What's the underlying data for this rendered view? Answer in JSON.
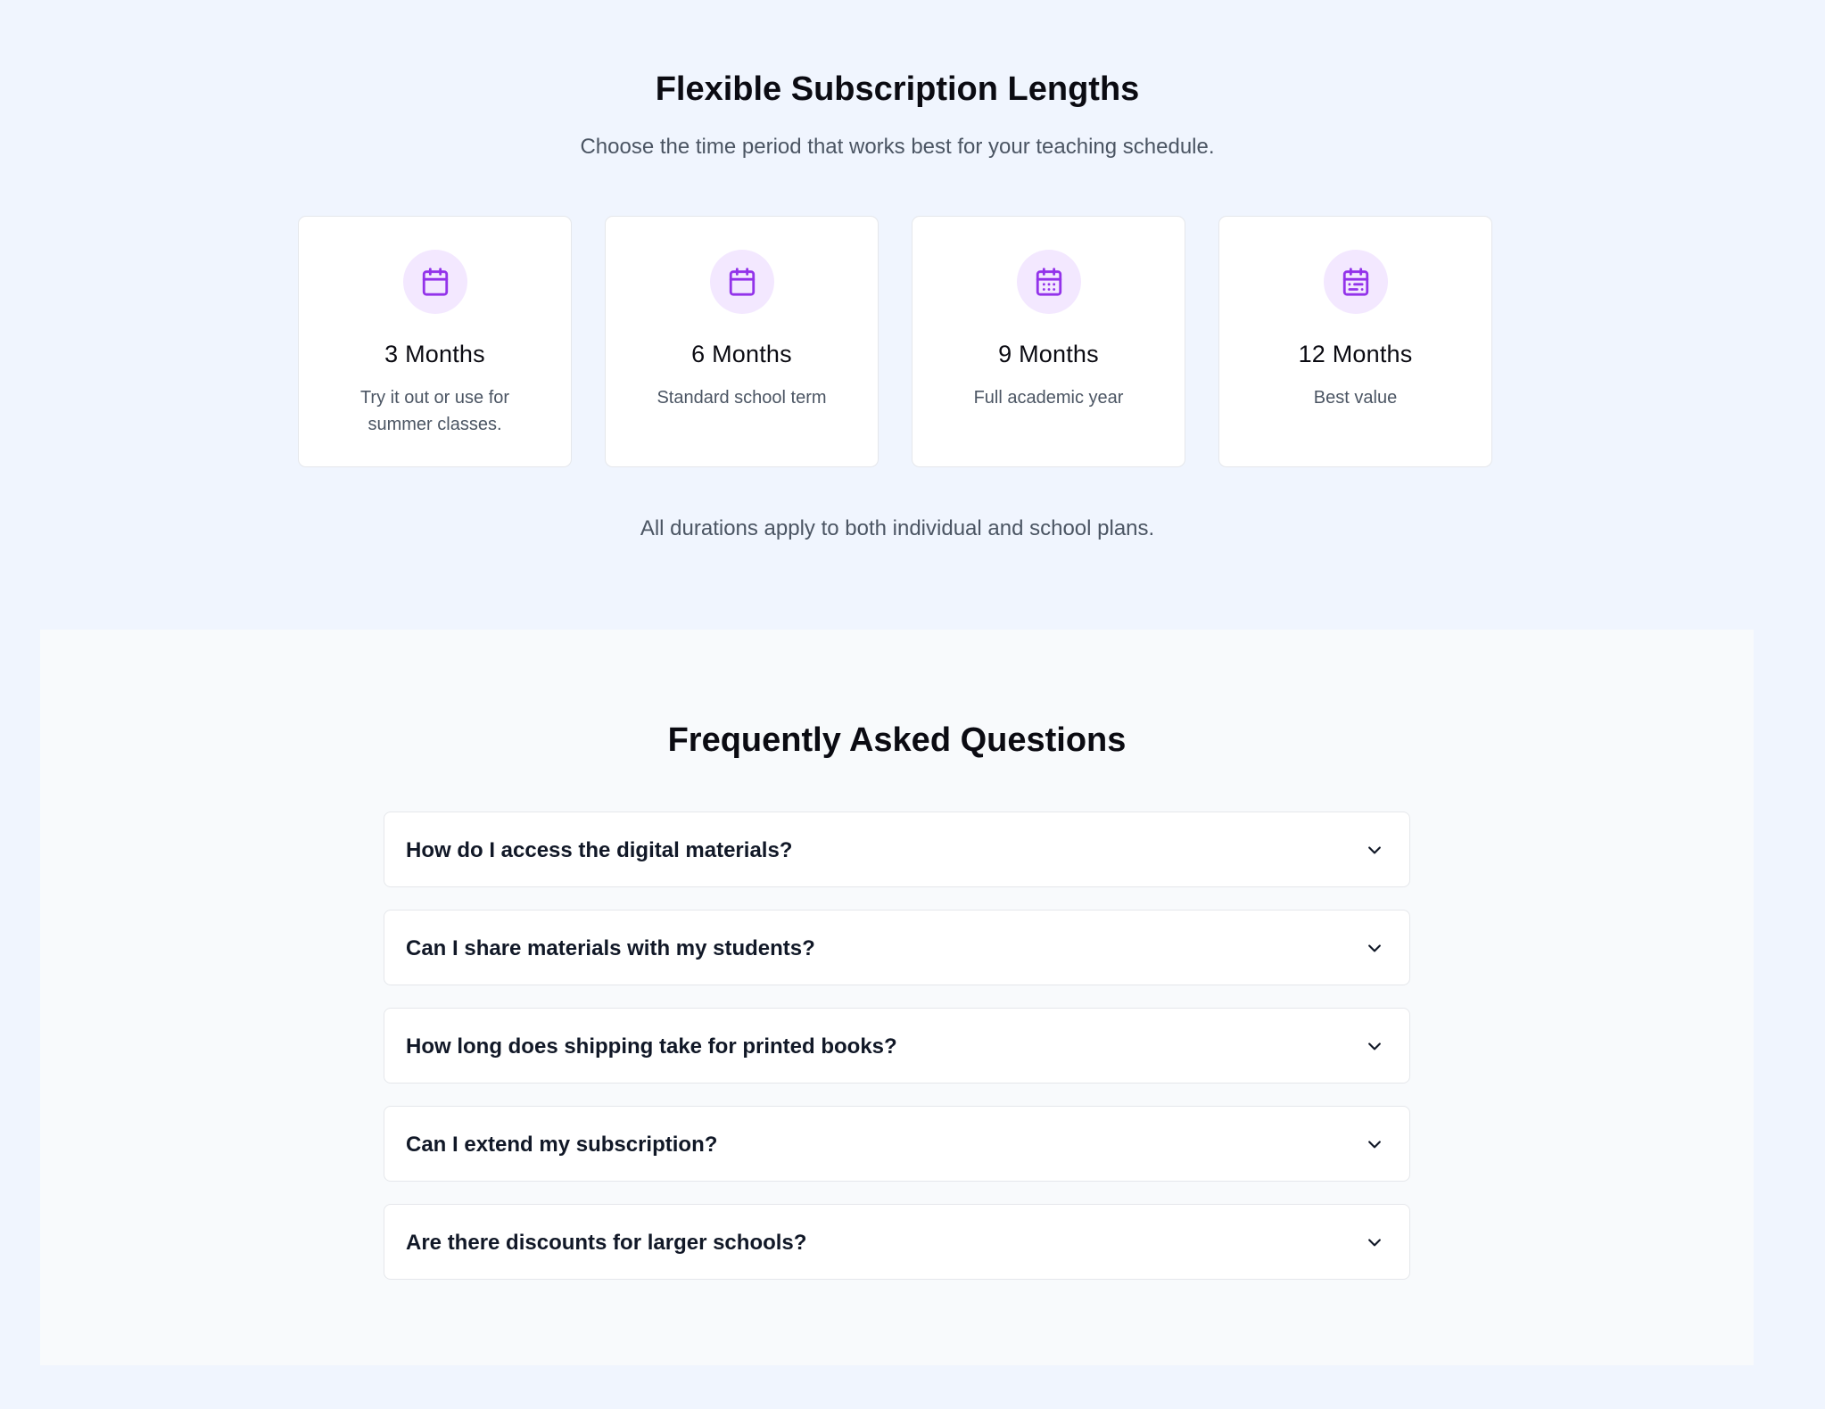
{
  "durations": {
    "title": "Flexible Subscription Lengths",
    "subtitle": "Choose the time period that works best for your teaching schedule.",
    "accent_color": "#9333ea",
    "icon_bg_color": "#f3e8ff",
    "cards": [
      {
        "icon": "calendar-icon",
        "title": "3 Months",
        "description": "Try it out or use for summer classes."
      },
      {
        "icon": "calendar-icon",
        "title": "6 Months",
        "description": "Standard school term"
      },
      {
        "icon": "calendar-days-icon",
        "title": "9 Months",
        "description": "Full academic year"
      },
      {
        "icon": "calendar-range-icon",
        "title": "12 Months",
        "description": "Best value"
      }
    ],
    "note": "All durations apply to both individual and school plans."
  },
  "faq": {
    "title": "Frequently Asked Questions",
    "items": [
      {
        "question": "How do I access the digital materials?"
      },
      {
        "question": "Can I share materials with my students?"
      },
      {
        "question": "How long does shipping take for printed books?"
      },
      {
        "question": "Can I extend my subscription?"
      },
      {
        "question": "Are there discounts for larger schools?"
      }
    ]
  }
}
